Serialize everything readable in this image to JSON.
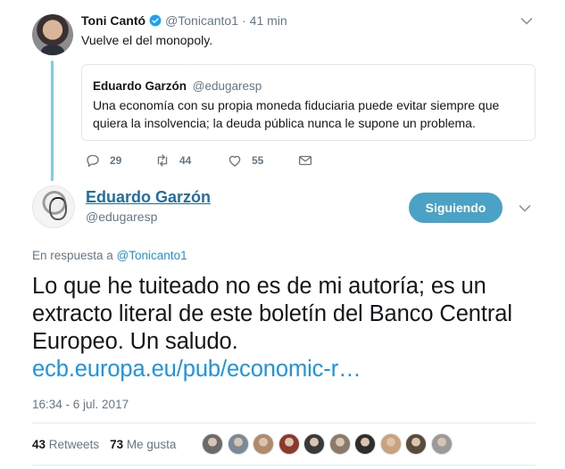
{
  "parent_tweet": {
    "name": "Toni Cantó",
    "handle": "@Tonicanto1",
    "separator": "·",
    "time": "41 min",
    "text": "Vuelve el del monopoly.",
    "quoted": {
      "name": "Eduardo Garzón",
      "handle": "@edugaresp",
      "text": "Una economía con su propia moneda fiduciaria puede evitar siempre que quiera la insolvencia; la deuda pública nunca le supone un problema."
    },
    "actions": {
      "replies": "29",
      "retweets": "44",
      "likes": "55"
    }
  },
  "main_tweet": {
    "name": "Eduardo Garzón",
    "handle": "@edugaresp",
    "follow_label": "Siguiendo",
    "reply_prefix": "En respuesta a",
    "reply_mention": "@Tonicanto1",
    "text": "Lo que he tuiteado no es de mi autoría; es un extracto literal de este boletín del Banco Central Europeo. Un saludo.",
    "link": "ecb.europa.eu/pub/economic-r…",
    "timestamp": "16:34 - 6 jul. 2017",
    "retweet_count": "43",
    "retweet_label": "Retweets",
    "like_count": "73",
    "like_label": "Me gusta",
    "liker_colors": [
      "#6b6b6b",
      "#7a8a99",
      "#b08a6a",
      "#8b3a2a",
      "#3a3a3a",
      "#8a7a6a",
      "#2e2e2e",
      "#c9a27e",
      "#5a4a3a",
      "#9a9a9a"
    ]
  },
  "colors": {
    "accent": "#1b95e0",
    "follow_button": "#4aa3c6",
    "thread_line": "#7fcbe0",
    "verified": "#1da1f2"
  }
}
